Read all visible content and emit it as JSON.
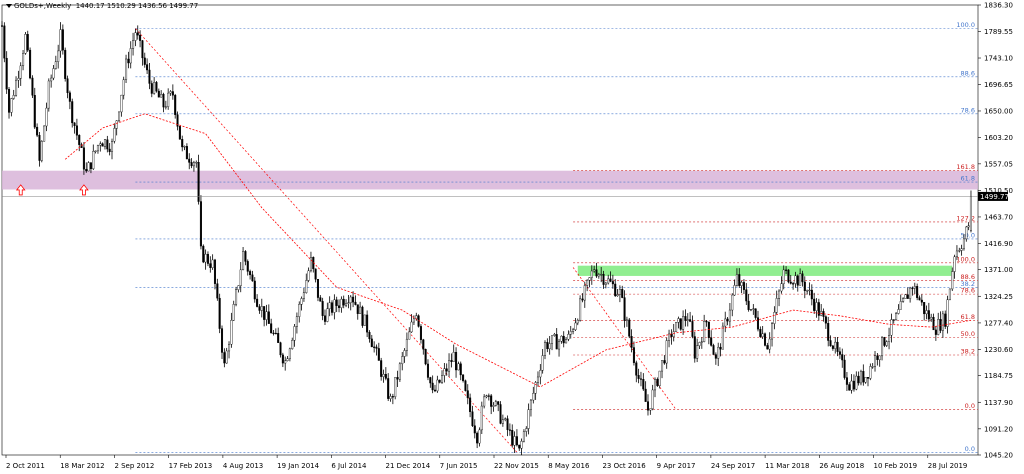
{
  "header": {
    "symbol_label": "GOLDs+,Weekly",
    "ohlc": "1440.17 1510.29 1436.56 1499.77"
  },
  "colors": {
    "candle": "#000000",
    "axis_text": "#000000",
    "ma": "#ff0000",
    "fib_blue": "#4477cc",
    "fib_red": "#cc2222",
    "price_tag_bg": "#000000",
    "price_tag_text": "#ffffff",
    "zone_purple": "#d8b4d8",
    "zone_green": "#90ee90",
    "arrow": "#ff0000"
  },
  "chart_data": {
    "type": "candlestick",
    "title": "GOLDs+,Weekly",
    "timeframe": "Weekly",
    "ohlc_last": {
      "open": 1440.17,
      "high": 1510.29,
      "low": 1436.56,
      "close": 1499.77
    },
    "current_price": 1499.77,
    "ylim": [
      1045.2,
      1836.3
    ],
    "y_ticks": [
      "1836.30",
      "1789.55",
      "1743.10",
      "1696.65",
      "1650.00",
      "1603.20",
      "1557.05",
      "1510.50",
      "1463.70",
      "1416.90",
      "1371.00",
      "1324.25",
      "1277.40",
      "1230.60",
      "1184.75",
      "1137.90",
      "1091.20",
      "1045.20"
    ],
    "x_tick_labels": [
      "2 Oct 2011",
      "18 Mar 2012",
      "2 Sep 2012",
      "17 Feb 2013",
      "4 Aug 2013",
      "19 Jan 2014",
      "6 Jul 2014",
      "21 Dec 2014",
      "7 Jun 2015",
      "22 Nov 2015",
      "8 May 2016",
      "23 Oct 2016",
      "9 Apr 2017",
      "24 Sep 2017",
      "11 Mar 2018",
      "26 Aug 2018",
      "10 Feb 2019",
      "28 Jul 2019"
    ],
    "anchor_points": [
      {
        "date": "2011-09-04",
        "price": 1800
      },
      {
        "date": "2011-09-25",
        "price": 1650
      },
      {
        "date": "2011-10-23",
        "price": 1720
      },
      {
        "date": "2011-11-13",
        "price": 1780
      },
      {
        "date": "2011-12-25",
        "price": 1560
      },
      {
        "date": "2012-01-22",
        "price": 1690
      },
      {
        "date": "2012-02-26",
        "price": 1780
      },
      {
        "date": "2012-03-25",
        "price": 1660
      },
      {
        "date": "2012-05-13",
        "price": 1540
      },
      {
        "date": "2012-06-24",
        "price": 1600
      },
      {
        "date": "2012-07-29",
        "price": 1590
      },
      {
        "date": "2012-09-09",
        "price": 1730
      },
      {
        "date": "2012-10-07",
        "price": 1790
      },
      {
        "date": "2012-11-18",
        "price": 1700
      },
      {
        "date": "2012-12-30",
        "price": 1660
      },
      {
        "date": "2013-01-27",
        "price": 1680
      },
      {
        "date": "2013-02-24",
        "price": 1580
      },
      {
        "date": "2013-04-07",
        "price": 1560
      },
      {
        "date": "2013-04-21",
        "price": 1400
      },
      {
        "date": "2013-05-26",
        "price": 1380
      },
      {
        "date": "2013-06-30",
        "price": 1200
      },
      {
        "date": "2013-08-25",
        "price": 1400
      },
      {
        "date": "2013-10-06",
        "price": 1320
      },
      {
        "date": "2013-12-29",
        "price": 1210
      },
      {
        "date": "2014-03-16",
        "price": 1385
      },
      {
        "date": "2014-04-20",
        "price": 1290
      },
      {
        "date": "2014-07-13",
        "price": 1330
      },
      {
        "date": "2014-09-07",
        "price": 1260
      },
      {
        "date": "2014-11-09",
        "price": 1140
      },
      {
        "date": "2015-01-25",
        "price": 1300
      },
      {
        "date": "2015-03-15",
        "price": 1150
      },
      {
        "date": "2015-05-17",
        "price": 1220
      },
      {
        "date": "2015-07-26",
        "price": 1080
      },
      {
        "date": "2015-08-23",
        "price": 1160
      },
      {
        "date": "2015-11-29",
        "price": 1050
      },
      {
        "date": "2016-02-14",
        "price": 1240
      },
      {
        "date": "2016-04-24",
        "price": 1250
      },
      {
        "date": "2016-07-10",
        "price": 1375
      },
      {
        "date": "2016-09-25",
        "price": 1330
      },
      {
        "date": "2016-11-20",
        "price": 1180
      },
      {
        "date": "2016-12-18",
        "price": 1125
      },
      {
        "date": "2017-02-26",
        "price": 1260
      },
      {
        "date": "2017-04-16",
        "price": 1290
      },
      {
        "date": "2017-05-07",
        "price": 1225
      },
      {
        "date": "2017-06-11",
        "price": 1280
      },
      {
        "date": "2017-07-09",
        "price": 1210
      },
      {
        "date": "2017-09-10",
        "price": 1355
      },
      {
        "date": "2017-12-10",
        "price": 1240
      },
      {
        "date": "2018-01-28",
        "price": 1365
      },
      {
        "date": "2018-03-25",
        "price": 1350
      },
      {
        "date": "2018-05-20",
        "price": 1290
      },
      {
        "date": "2018-08-12",
        "price": 1170
      },
      {
        "date": "2018-09-30",
        "price": 1185
      },
      {
        "date": "2018-12-30",
        "price": 1285
      },
      {
        "date": "2019-02-17",
        "price": 1345
      },
      {
        "date": "2019-03-24",
        "price": 1300
      },
      {
        "date": "2019-04-28",
        "price": 1270
      },
      {
        "date": "2019-05-26",
        "price": 1285
      },
      {
        "date": "2019-06-23",
        "price": 1400
      },
      {
        "date": "2019-07-21",
        "price": 1425
      },
      {
        "date": "2019-08-04",
        "price": 1450
      },
      {
        "date": "2019-08-11",
        "price": 1500
      }
    ],
    "ma_anchor_points": [
      {
        "date": "2012-03-11",
        "price": 1565
      },
      {
        "date": "2012-07-01",
        "price": 1620
      },
      {
        "date": "2012-11-04",
        "price": 1645
      },
      {
        "date": "2013-05-05",
        "price": 1610
      },
      {
        "date": "2013-10-20",
        "price": 1480
      },
      {
        "date": "2014-06-01",
        "price": 1340
      },
      {
        "date": "2014-12-14",
        "price": 1300
      },
      {
        "date": "2015-05-24",
        "price": 1240
      },
      {
        "date": "2016-01-31",
        "price": 1165
      },
      {
        "date": "2016-08-14",
        "price": 1230
      },
      {
        "date": "2017-03-12",
        "price": 1260
      },
      {
        "date": "2017-08-27",
        "price": 1270
      },
      {
        "date": "2018-02-25",
        "price": 1300
      },
      {
        "date": "2018-07-15",
        "price": 1290
      },
      {
        "date": "2018-12-09",
        "price": 1275
      },
      {
        "date": "2019-04-14",
        "price": 1270
      },
      {
        "date": "2019-08-11",
        "price": 1282
      }
    ],
    "fib_blue_levels": [
      {
        "label": "100.0",
        "price": 1795
      },
      {
        "label": "88.6",
        "price": 1710
      },
      {
        "label": "78.6",
        "price": 1645
      },
      {
        "label": "61.8",
        "price": 1525
      },
      {
        "label": "50.0",
        "price": 1425
      },
      {
        "label": "38.2",
        "price": 1340
      },
      {
        "label": "0.0",
        "price": 1050
      }
    ],
    "fib_red_levels": [
      {
        "label": "161.8",
        "price": 1545
      },
      {
        "label": "127.2",
        "price": 1455
      },
      {
        "label": "100.0",
        "price": 1383
      },
      {
        "label": "88.6",
        "price": 1352
      },
      {
        "label": "78.6",
        "price": 1328
      },
      {
        "label": "61.8",
        "price": 1282
      },
      {
        "label": "50.0",
        "price": 1252
      },
      {
        "label": "38.2",
        "price": 1221
      },
      {
        "label": "0.0",
        "price": 1125
      }
    ],
    "zones": [
      {
        "color": "purple",
        "from": "2011-09-04",
        "to": "2019-09-01",
        "price_low": 1512,
        "price_high": 1545
      },
      {
        "color": "green",
        "from": "2016-05-22",
        "to": "2019-06-16",
        "price_low": 1360,
        "price_high": 1378
      }
    ],
    "arrows": [
      {
        "date": "2011-10-30",
        "price": 1520
      },
      {
        "date": "2012-05-06",
        "price": 1520
      }
    ],
    "trendlines": [
      {
        "from": {
          "date": "2012-10-07",
          "price": 1795
        },
        "to": {
          "date": "2015-11-22",
          "price": 1050
        }
      },
      {
        "from": {
          "date": "2016-05-08",
          "price": 1375
        },
        "to": {
          "date": "2017-03-12",
          "price": 1125
        }
      }
    ]
  }
}
